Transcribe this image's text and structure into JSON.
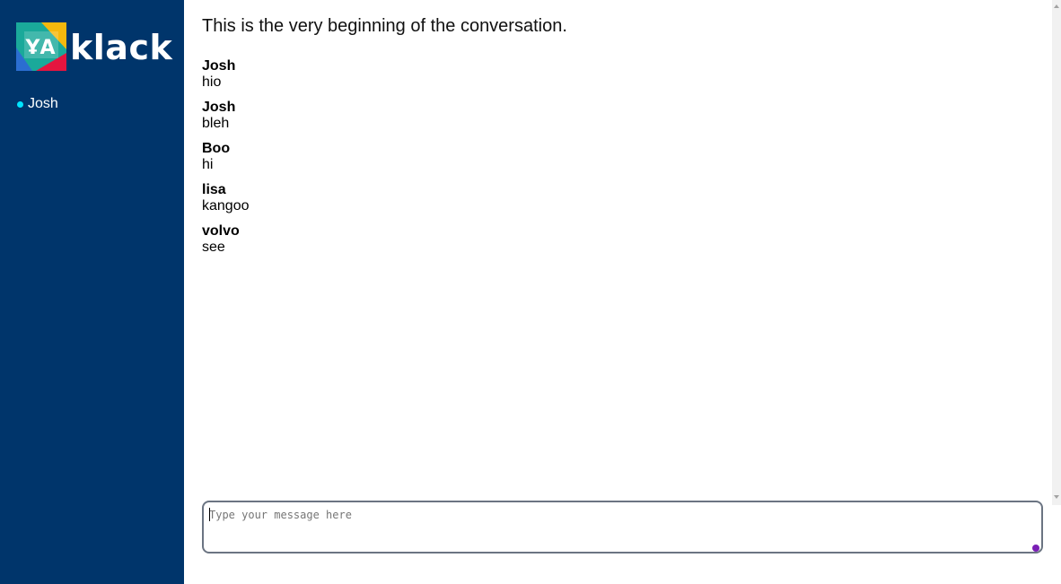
{
  "app": {
    "brand": "klack",
    "colors": {
      "sidebar": "#00356b",
      "online": "#00e5ff",
      "logo_teal": "#1aa99a",
      "logo_yellow": "#f6b80d",
      "logo_red": "#e5153f",
      "logo_blue": "#2b6ed1",
      "grip": "#7a1fb5"
    }
  },
  "sidebar": {
    "users": [
      {
        "name": "Josh",
        "status_icon": "online-dot-icon"
      }
    ]
  },
  "conversation": {
    "intro": "This is the very beginning of the conversation.",
    "messages": [
      {
        "author": "Josh",
        "text": "hio"
      },
      {
        "author": "Josh",
        "text": "bleh"
      },
      {
        "author": "Boo",
        "text": "hi"
      },
      {
        "author": "lisa",
        "text": "kangoo"
      },
      {
        "author": "volvo",
        "text": "see"
      }
    ]
  },
  "composer": {
    "placeholder": "Type your message here",
    "value": ""
  }
}
